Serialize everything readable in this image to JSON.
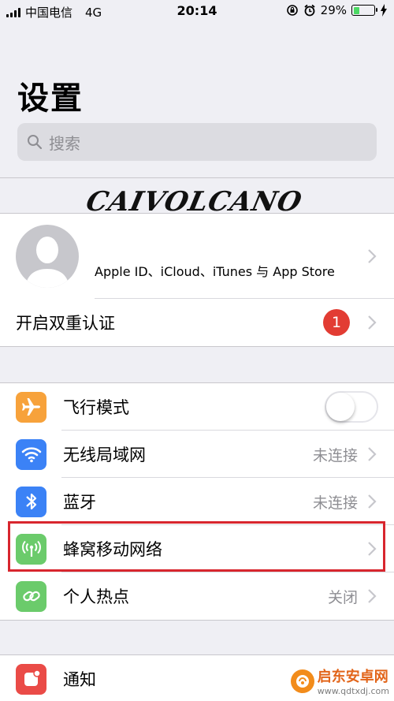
{
  "status_bar": {
    "carrier": "中国电信",
    "network": "4G",
    "time": "20:14",
    "battery_percent": "29%",
    "battery_level": 0.29
  },
  "header": {
    "title": "设置",
    "search_placeholder": "搜索"
  },
  "watermark": "CAIVOLCANO",
  "account": {
    "apple_id_label": "Apple ID、iCloud、iTunes 与 App Store",
    "two_factor_label": "开启双重认证",
    "badge_count": "1"
  },
  "connectivity": [
    {
      "label": "飞行模式",
      "value": "",
      "icon": "airplane-icon",
      "color": "#f7a23b",
      "toggle": true,
      "toggle_on": false
    },
    {
      "label": "无线局域网",
      "value": "未连接",
      "icon": "wifi-icon",
      "color": "#3b82f6"
    },
    {
      "label": "蓝牙",
      "value": "未连接",
      "icon": "bluetooth-icon",
      "color": "#3b82f6"
    },
    {
      "label": "蜂窝移动网络",
      "value": "",
      "icon": "antenna-icon",
      "color": "#6bcb6b"
    },
    {
      "label": "个人热点",
      "value": "关闭",
      "icon": "hotspot-icon",
      "color": "#6bcb6b"
    }
  ],
  "notifications": {
    "label": "通知",
    "icon": "notification-icon",
    "color": "#ea4b47"
  },
  "brand": {
    "name": "启东安卓网",
    "url": "www.qdtxdj.com"
  }
}
